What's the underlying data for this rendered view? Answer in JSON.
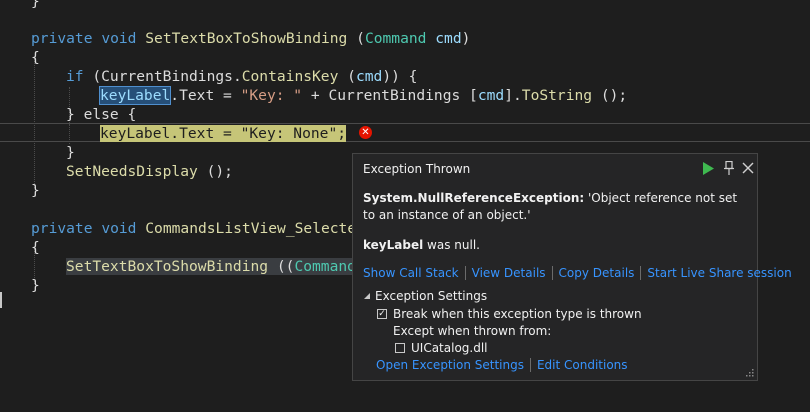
{
  "code": {
    "line0": "}",
    "sig1": {
      "kw1": "private",
      "kw2": "void",
      "name": "SetTextBoxToShowBinding",
      "p1": " (",
      "ptype": "Command",
      "pname": "cmd",
      "p2": ")"
    },
    "brace_open": "{",
    "if_line": {
      "kw": "if",
      "a": " (CurrentBindings.",
      "m": "ContainsKey",
      "b": " (",
      "p": "cmd",
      "c": ")) {"
    },
    "assign1": {
      "var": "keyLabel",
      "a": ".Text = ",
      "s": "\"Key: \"",
      "b": " + CurrentBindings [",
      "p": "cmd",
      "c": "].",
      "m": "ToString",
      "d": " ();"
    },
    "else_line": "} else {",
    "assign2": {
      "var": "keyLabel",
      "a": ".Text = ",
      "s": "\"Key: None\"",
      "b": ";"
    },
    "brace_close_inner": "}",
    "call_line": {
      "m": "SetNeedsDisplay",
      "a": " ();"
    },
    "brace_close": "}",
    "sig2": {
      "kw1": "private",
      "kw2": "void",
      "name": "CommandsListView_Selecte"
    },
    "brace_open2": "{",
    "call2": {
      "m": "SetTextBoxToShowBinding",
      "a": " ((",
      "t": "Command"
    },
    "brace_close2": "}"
  },
  "popup": {
    "title": "Exception Thrown",
    "exception_type": "System.NullReferenceException:",
    "message": " 'Object reference not set to an instance of an object.'",
    "null_var": "keyLabel",
    "null_text": " was null.",
    "links": [
      "Show Call Stack",
      "View Details",
      "Copy Details",
      "Start Live Share session"
    ],
    "settings_header": "Exception Settings",
    "break_label": "Break when this exception type is thrown",
    "break_checked": true,
    "except_label": "Except when thrown from:",
    "module_label": "UICatalog.dll",
    "module_checked": false,
    "bottom_links": [
      "Open Exception Settings",
      "Edit Conditions"
    ],
    "icons": {
      "play": "play-icon",
      "pin": "pin-icon",
      "close": "close-icon",
      "error": "error-icon",
      "grip": "resize-grip-icon"
    }
  },
  "colors": {
    "background": "#1e1e1e",
    "keyword": "#569cd6",
    "type": "#4ec9b0",
    "method": "#dcdcaa",
    "string": "#d69d85",
    "link": "#3794ff",
    "error": "#e51400"
  }
}
